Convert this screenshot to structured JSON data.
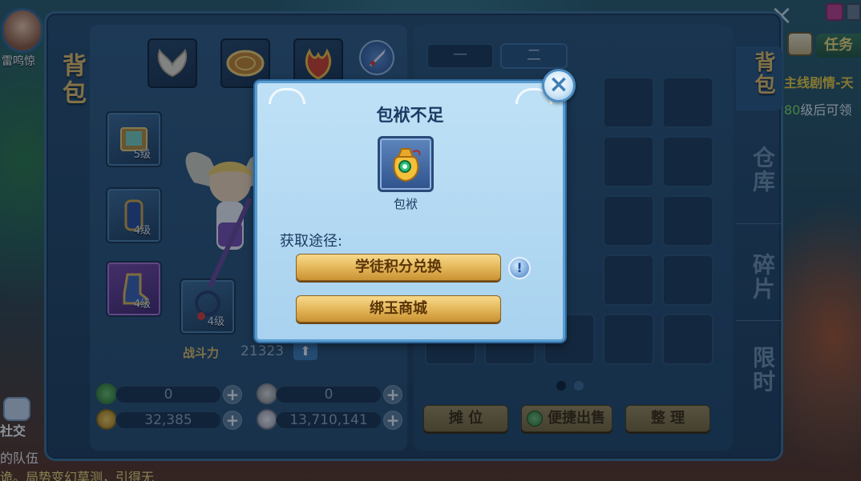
{
  "hud": {
    "player_name": "雷鸣惊",
    "social_label": "社交",
    "task_tab": "任务",
    "main_quest": "主线剧情-天",
    "level_hint_num": "80",
    "level_hint_text": "级后可领",
    "chat_line1": "的队伍",
    "chat_line2": "诡。局势变幻莫测，引得无"
  },
  "bag": {
    "title": "背包",
    "equip_levels": [
      "5级",
      "4级",
      "4级",
      "4级"
    ],
    "combat_label": "战斗力",
    "combat_value": "21323",
    "currencies": [
      "0",
      "0",
      "32,385",
      "13,710,141"
    ],
    "page_tabs": [
      "一",
      "二"
    ],
    "buttons": {
      "stall": "摊 位",
      "quick_sell": "便捷出售",
      "sort": "整 理"
    },
    "side_tabs": [
      "背包",
      "仓库",
      "碎片",
      "限时"
    ]
  },
  "dialog": {
    "title": "包袱不足",
    "item_name": "包袱",
    "source_label": "获取途径:",
    "option1": "学徒积分兑换",
    "option2": "绑玉商城",
    "info_glyph": "!",
    "close_glyph": "×"
  },
  "colors": {
    "gold_button": "#e2b456",
    "dialog_bg": "#bfe1f6",
    "title_gold": "#e8c26a"
  }
}
